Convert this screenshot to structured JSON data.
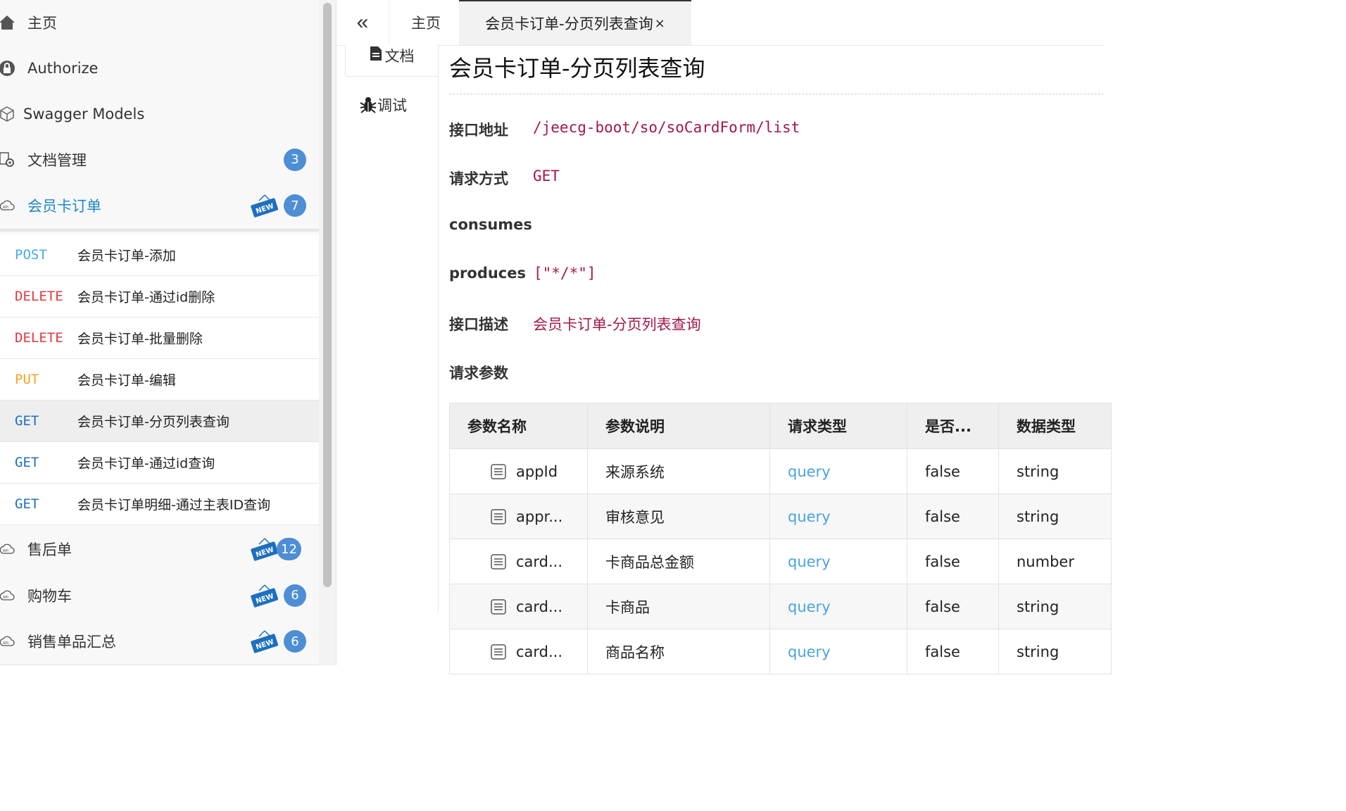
{
  "sidebar": {
    "top_items": [
      {
        "label": "主页",
        "icon": "home-icon"
      },
      {
        "label": "Authorize",
        "icon": "lock-icon"
      },
      {
        "label": "Swagger Models",
        "icon": "cube-icon"
      },
      {
        "label": "文档管理",
        "icon": "doc-gear-icon",
        "badge": "3"
      },
      {
        "label": "会员卡订单",
        "icon": "api-cloud-icon",
        "badge": "7",
        "new": true
      }
    ],
    "apis": [
      {
        "method": "POST",
        "name": "会员卡订单-添加"
      },
      {
        "method": "DELETE",
        "name": "会员卡订单-通过id删除"
      },
      {
        "method": "DELETE",
        "name": "会员卡订单-批量删除"
      },
      {
        "method": "PUT",
        "name": "会员卡订单-编辑"
      },
      {
        "method": "GET",
        "name": "会员卡订单-分页列表查询"
      },
      {
        "method": "GET",
        "name": "会员卡订单-通过id查询"
      },
      {
        "method": "GET",
        "name": "会员卡订单明细-通过主表ID查询"
      }
    ],
    "groups": [
      {
        "label": "售后单",
        "icon": "api-cloud-icon",
        "badge": "12",
        "new": true
      },
      {
        "label": "购物车",
        "icon": "api-cloud-icon",
        "badge": "6",
        "new": true
      },
      {
        "label": "销售单品汇总",
        "icon": "api-cloud-icon",
        "badge": "6",
        "new": true
      }
    ],
    "new_label": "NEW"
  },
  "colors": {
    "POST": "#49a9e6",
    "DELETE": "#e0393e",
    "PUT": "#f4a623",
    "GET": "#1d6fbf",
    "badge": "#4d8ed4",
    "accent": "#1e88c8",
    "value": "#a3174b"
  },
  "tabs": {
    "collapse": "«",
    "home": "主页",
    "active": "会员卡订单-分页列表查询",
    "close": "×"
  },
  "subtabs": {
    "doc": "文档",
    "debug": "调试"
  },
  "doc": {
    "title": "会员卡订单-分页列表查询",
    "url_label": "接口地址",
    "url": "/jeecg-boot/so/soCardForm/list",
    "method_label": "请求方式",
    "method": "GET",
    "consumes_label": "consumes",
    "produces_label": "produces",
    "produces": "[\"*/*\"]",
    "desc_label": "接口描述",
    "desc": "会员卡订单-分页列表查询",
    "params_label": "请求参数"
  },
  "params": {
    "headers": [
      "参数名称",
      "参数说明",
      "请求类型",
      "是否...",
      "数据类型"
    ],
    "rows": [
      [
        "appId",
        "来源系统",
        "query",
        "false",
        "string"
      ],
      [
        "appr...",
        "审核意见",
        "query",
        "false",
        "string"
      ],
      [
        "card...",
        "卡商品总金额",
        "query",
        "false",
        "number"
      ],
      [
        "card...",
        "卡商品",
        "query",
        "false",
        "string"
      ],
      [
        "card...",
        "商品名称",
        "query",
        "false",
        "string"
      ]
    ]
  }
}
